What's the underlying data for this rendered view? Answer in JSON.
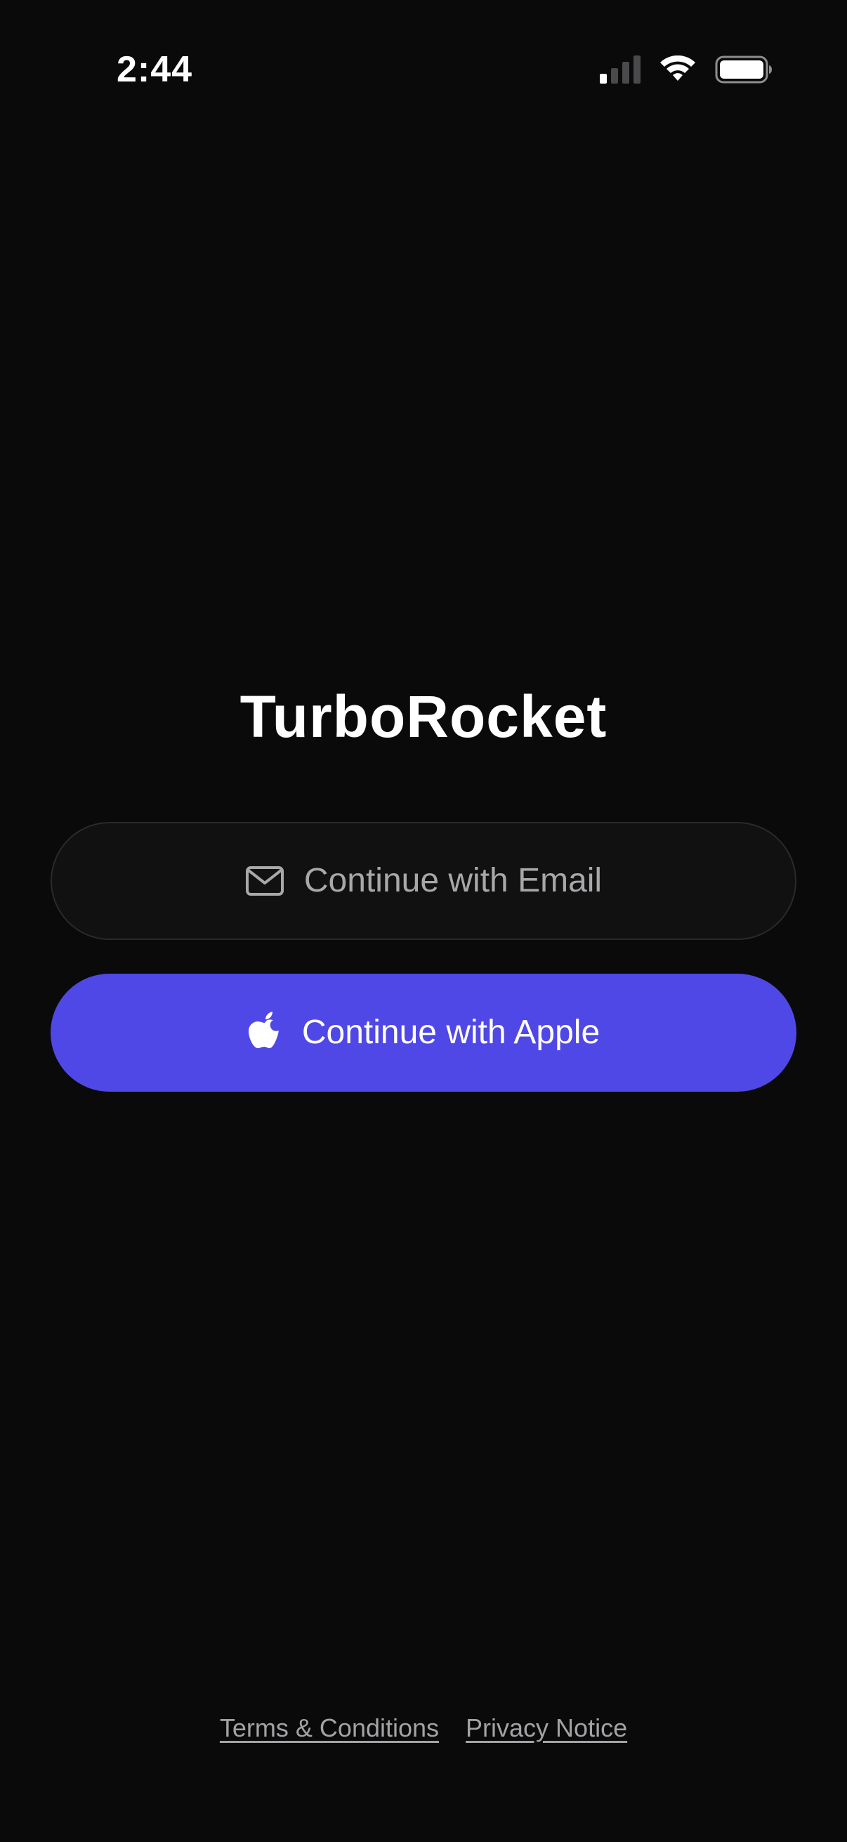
{
  "status_bar": {
    "time": "2:44",
    "icons": [
      "cellular-signal-icon",
      "wifi-icon",
      "battery-icon"
    ]
  },
  "app": {
    "title": "TurboRocket"
  },
  "auth": {
    "email_button_label": "Continue with Email",
    "email_icon": "mail-icon",
    "apple_button_label": "Continue with Apple",
    "apple_icon": "apple-icon"
  },
  "footer": {
    "terms_label": "Terms & Conditions",
    "privacy_label": "Privacy Notice"
  },
  "colors": {
    "background": "#0a0a0b",
    "email_button_bg": "#111112",
    "email_button_border": "#2a2a2c",
    "email_button_text": "#a8a8ab",
    "apple_button_bg": "#5048e6",
    "apple_button_text": "#ffffff",
    "footer_link_text": "#a3a3a6"
  }
}
